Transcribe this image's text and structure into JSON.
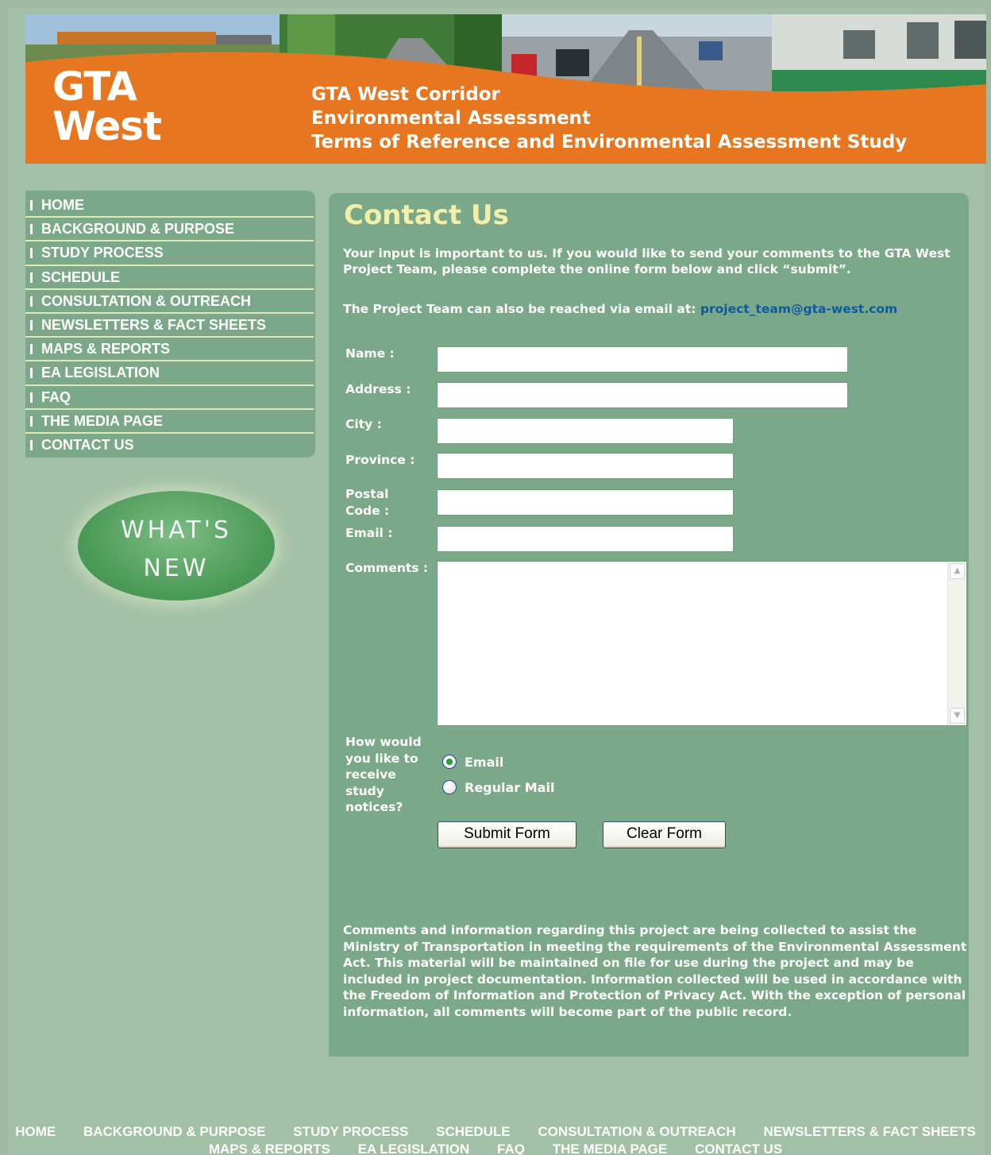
{
  "banner": {
    "logo_line1": "GTA",
    "logo_line2": "West",
    "title_line1": "GTA West Corridor",
    "title_line2": "Environmental Assessment",
    "title_line3": "Terms of Reference and Environmental Assessment Study"
  },
  "nav": {
    "items": [
      {
        "label": "HOME"
      },
      {
        "label": "BACKGROUND & PURPOSE"
      },
      {
        "label": "STUDY PROCESS"
      },
      {
        "label": "SCHEDULE"
      },
      {
        "label": "CONSULTATION & OUTREACH"
      },
      {
        "label": "NEWSLETTERS & FACT SHEETS"
      },
      {
        "label": "MAPS & REPORTS"
      },
      {
        "label": "EA LEGISLATION"
      },
      {
        "label": "FAQ"
      },
      {
        "label": "THE MEDIA PAGE"
      },
      {
        "label": "CONTACT US"
      }
    ]
  },
  "whats_new": {
    "line1": "WHAT'S",
    "line2": "NEW"
  },
  "page": {
    "title": "Contact Us",
    "intro": "Your input is important to us. If you would like to send your comments to the GTA West Project Team, please complete the online form below and click “submit”.",
    "email_prefix": "The Project Team can also be reached via email at: ",
    "email_link": "project_team@gta-west.com"
  },
  "form": {
    "name_label": "Name :",
    "name_value": "",
    "address_label": "Address :",
    "address_value": "",
    "city_label": "City :",
    "city_value": "",
    "province_label": "Province :",
    "province_value": "",
    "postal_label_1": "Postal",
    "postal_label_2": "Code :",
    "postal_value": "",
    "email_label": "Email :",
    "email_value": "",
    "comments_label": "Comments :",
    "comments_value": "",
    "notice_q1": "How would",
    "notice_q2": "you like to",
    "notice_q3": "receive",
    "notice_q4": "study",
    "notice_q5": "notices?",
    "option_email": "Email",
    "option_mail": "Regular Mail",
    "selected_option": "Email",
    "submit_label": "Submit Form",
    "clear_label": "Clear Form"
  },
  "disclaimer": "Comments and information regarding this project are being collected to assist the Ministry of Transportation in meeting the requirements of the Environmental Assessment Act. This material will be maintained on file for use during the project and may be included in project documentation. Information collected will be used in accordance with the Freedom of Information and Protection of Privacy Act. With the exception of personal information, all comments will become part of the public record.",
  "footer": {
    "row1": [
      "HOME",
      "BACKGROUND & PURPOSE",
      "STUDY PROCESS",
      "SCHEDULE",
      "CONSULTATION & OUTREACH",
      "NEWSLETTERS & FACT SHEETS"
    ],
    "row2": [
      "MAPS & REPORTS",
      "EA LEGISLATION",
      "FAQ",
      "THE MEDIA PAGE",
      "CONTACT US"
    ]
  },
  "colors": {
    "banner_orange": "#e6761f",
    "panel_green": "#7aa888",
    "background_green": "#a2c0a5",
    "title_yellow": "#f2f0a8",
    "link_blue": "#0e5aa0"
  }
}
